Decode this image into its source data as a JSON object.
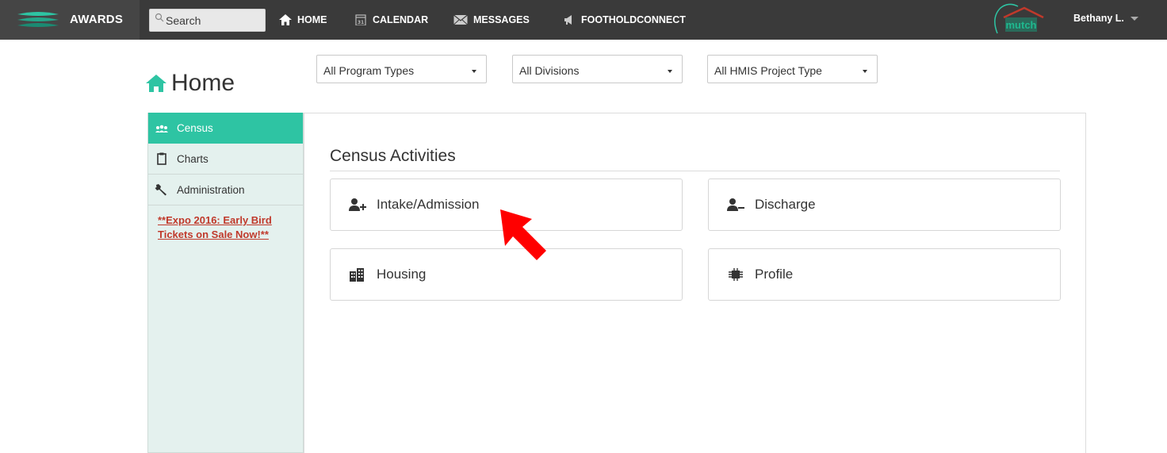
{
  "navbar": {
    "brand": "AWARDS",
    "search_placeholder": "Search",
    "items": [
      {
        "label": "HOME",
        "icon": "home-icon"
      },
      {
        "label": "CALENDAR",
        "icon": "calendar-icon"
      },
      {
        "label": "MESSAGES",
        "icon": "envelope-icon"
      },
      {
        "label": "FOOTHOLDCONNECT",
        "icon": "megaphone-icon"
      }
    ],
    "org_logo_text": "mutch",
    "user": "Bethany L."
  },
  "page": {
    "title": "Home"
  },
  "filters": {
    "program_types": "All Program Types",
    "divisions": "All Divisions",
    "hmis_project_type": "All HMIS Project Type"
  },
  "sidebar": {
    "items": [
      {
        "label": "Census",
        "icon": "users-icon",
        "active": true
      },
      {
        "label": "Charts",
        "icon": "clipboard-icon",
        "active": false
      },
      {
        "label": "Administration",
        "icon": "wrench-icon",
        "active": false
      }
    ],
    "promo_link": "**Expo 2016: Early Bird Tickets on Sale Now!**"
  },
  "main": {
    "section_title": "Census Activities",
    "tiles": [
      {
        "label": "Intake/Admission",
        "icon": "user-add-icon"
      },
      {
        "label": "Discharge",
        "icon": "user-remove-icon"
      },
      {
        "label": "Housing",
        "icon": "building-icon"
      },
      {
        "label": "Profile",
        "icon": "chip-icon"
      }
    ]
  },
  "colors": {
    "navbar_bg": "#3a3a3a",
    "accent": "#2ec4a3",
    "sidebar_bg": "#e4f1ee",
    "promo_link": "#c0392b",
    "pointer": "#ff0000"
  }
}
